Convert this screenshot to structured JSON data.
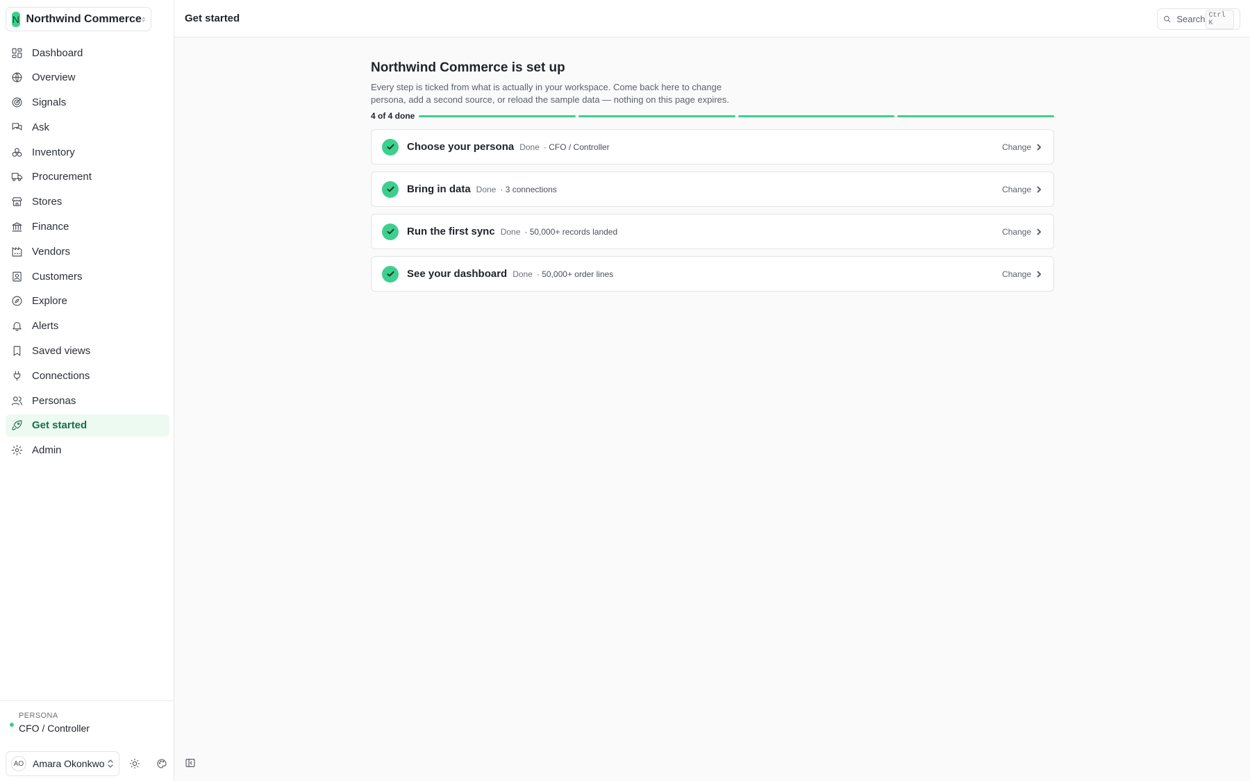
{
  "workspace": {
    "initial": "N",
    "name": "Northwind Commerce"
  },
  "header": {
    "title": "Get started",
    "search_label": "Search",
    "search_shortcut": "Ctrl K"
  },
  "sidebar": {
    "items": [
      {
        "label": "Dashboard",
        "icon": "dashboard-icon"
      },
      {
        "label": "Overview",
        "icon": "globe-icon"
      },
      {
        "label": "Signals",
        "icon": "radar-icon"
      },
      {
        "label": "Ask",
        "icon": "chat-icon"
      },
      {
        "label": "Inventory",
        "icon": "boxes-icon"
      },
      {
        "label": "Procurement",
        "icon": "truck-icon"
      },
      {
        "label": "Stores",
        "icon": "store-icon"
      },
      {
        "label": "Finance",
        "icon": "bank-icon"
      },
      {
        "label": "Vendors",
        "icon": "factory-icon"
      },
      {
        "label": "Customers",
        "icon": "contact-icon"
      },
      {
        "label": "Explore",
        "icon": "compass-icon"
      },
      {
        "label": "Alerts",
        "icon": "bell-icon"
      },
      {
        "label": "Saved views",
        "icon": "bookmark-icon"
      },
      {
        "label": "Connections",
        "icon": "plug-icon"
      },
      {
        "label": "Personas",
        "icon": "users-icon"
      },
      {
        "label": "Get started",
        "icon": "rocket-icon",
        "active": true
      },
      {
        "label": "Admin",
        "icon": "gear-icon"
      }
    ],
    "persona_label": "Persona",
    "persona_value": "CFO / Controller",
    "user": {
      "initials": "AO",
      "name": "Amara Okonkwo"
    }
  },
  "main": {
    "heading": "Northwind Commerce is set up",
    "description": "Every step is ticked from what is actually in your workspace. Come back here to change persona, add a second source, or reload the sample data — nothing on this page expires.",
    "progress_label": "4 of 4 done",
    "progress_steps": [
      1,
      1,
      1,
      1
    ],
    "steps": [
      {
        "title": "Choose your persona",
        "status": "Done",
        "detail": "· CFO / Controller",
        "action": "Change"
      },
      {
        "title": "Bring in data",
        "status": "Done",
        "detail": "· 3 connections",
        "action": "Change"
      },
      {
        "title": "Run the first sync",
        "status": "Done",
        "detail": "· 50,000+ records landed",
        "action": "Change"
      },
      {
        "title": "See your dashboard",
        "status": "Done",
        "detail": "· 50,000+ order lines",
        "action": "Change"
      }
    ]
  },
  "colors": {
    "accent": "#3ecf8e",
    "accent_text": "#157048",
    "active_bg": "#ecfaf2"
  }
}
